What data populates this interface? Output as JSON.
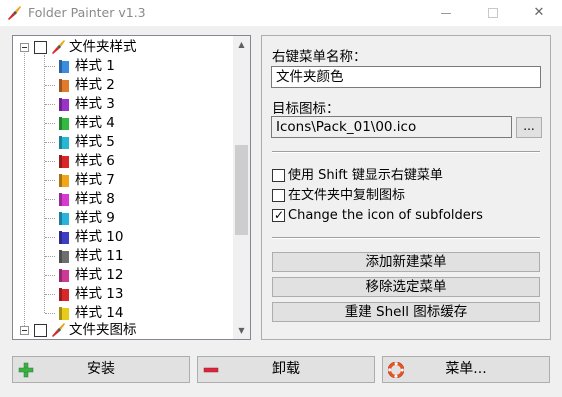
{
  "window": {
    "title": "Folder Painter v1.3"
  },
  "tree": {
    "groups": [
      {
        "label": "文件夹样式",
        "expanded": true,
        "checked": false,
        "children": [
          {
            "label": "样式 1",
            "color": "#3b8de0"
          },
          {
            "label": "样式 2",
            "color": "#e07a2c"
          },
          {
            "label": "样式 3",
            "color": "#9b33c9"
          },
          {
            "label": "样式 4",
            "color": "#33b93f"
          },
          {
            "label": "样式 5",
            "color": "#27b7d2"
          },
          {
            "label": "样式 6",
            "color": "#d8262a"
          },
          {
            "label": "样式 7",
            "color": "#f0a51a"
          },
          {
            "label": "样式 8",
            "color": "#d63ad0"
          },
          {
            "label": "样式 9",
            "color": "#2ab2de"
          },
          {
            "label": "样式 10",
            "color": "#3e3ec4"
          },
          {
            "label": "样式 11",
            "color": "#6e6e6e"
          },
          {
            "label": "样式 12",
            "color": "#cc3a96"
          },
          {
            "label": "样式 13",
            "color": "#d9282b"
          },
          {
            "label": "样式 14",
            "color": "#e8cc1c"
          }
        ]
      },
      {
        "label": "文件夹图标",
        "expanded": true,
        "checked": false,
        "children": []
      }
    ]
  },
  "settings": {
    "menu_name_label": "右键菜单名称：",
    "menu_name_value": "文件夹颜色",
    "target_icon_label": "目标图标：",
    "target_icon_value": "Icons\\Pack_01\\00.ico",
    "browse_label": "...",
    "checkboxes": [
      {
        "label": "使用 Shift 键显示右键菜单",
        "checked": false
      },
      {
        "label": "在文件夹中复制图标",
        "checked": false
      },
      {
        "label": "Change the icon of subfolders",
        "checked": true
      }
    ],
    "buttons": {
      "add_menu": "添加新建菜单",
      "remove_menu": "移除选定菜单",
      "rebuild_cache": "重建 Shell 图标缓存"
    }
  },
  "footer": {
    "install": "安装",
    "uninstall": "卸载",
    "menu": "菜单..."
  },
  "colors": {
    "install_icon": "#3cb043",
    "uninstall_icon": "#d7263d",
    "menu_icon": "#e8541d"
  }
}
